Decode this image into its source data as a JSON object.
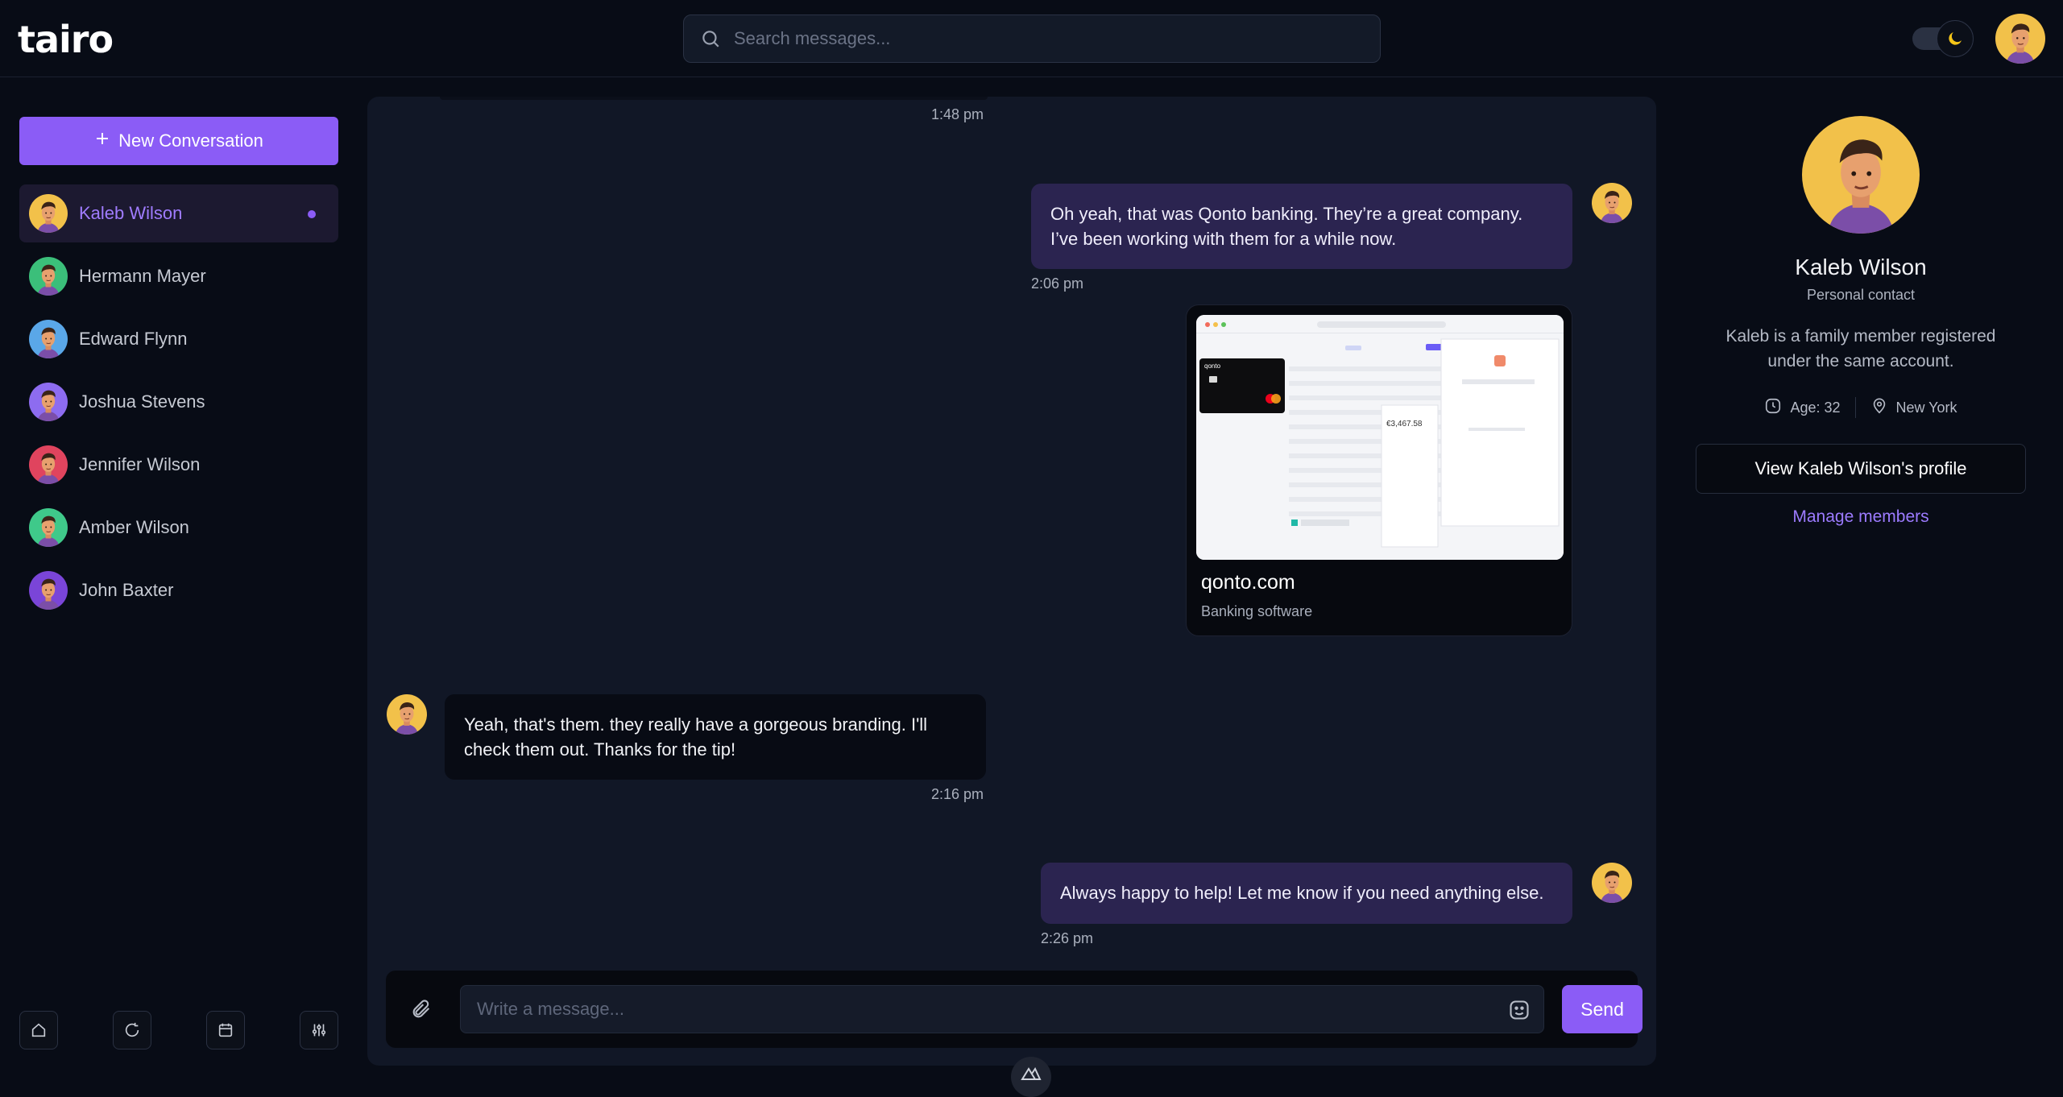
{
  "app": {
    "logo": "tairo"
  },
  "search": {
    "placeholder": "Search messages..."
  },
  "sidebar": {
    "new_conversation_label": "New Conversation",
    "contacts": [
      {
        "name": "Kaleb Wilson",
        "active": true,
        "unread": true,
        "avatar_bg": "#f2c14a"
      },
      {
        "name": "Hermann Mayer",
        "avatar_bg": "#3bbf7a"
      },
      {
        "name": "Edward Flynn",
        "avatar_bg": "#5aa7e8"
      },
      {
        "name": "Joshua Stevens",
        "avatar_bg": "#8d6cf0"
      },
      {
        "name": "Jennifer Wilson",
        "avatar_bg": "#e0445e"
      },
      {
        "name": "Amber Wilson",
        "avatar_bg": "#3fc98a"
      },
      {
        "name": "John Baxter",
        "avatar_bg": "#7a45d8"
      }
    ],
    "tools": [
      "home-icon",
      "chat-rotate-icon",
      "calendar-icon",
      "sliders-icon"
    ]
  },
  "chat": {
    "messages": [
      {
        "time": "1:48 pm"
      },
      {
        "direction": "out",
        "text": "Oh yeah, that was Qonto banking. They’re a great company. I’ve been working with them for a while now.",
        "time": "2:06 pm"
      },
      {
        "type": "link",
        "domain": "qonto.com",
        "description": "Banking software",
        "brand": "qonto",
        "preview_amount": "€3,467.58"
      },
      {
        "direction": "in",
        "text": "Yeah, that's them. they really have a gorgeous branding. I'll check them out. Thanks for the tip!",
        "time": "2:16 pm"
      },
      {
        "direction": "out",
        "text": "Always happy to help! Let me know if you need anything else.",
        "time": "2:26 pm"
      }
    ],
    "composer": {
      "placeholder": "Write a message...",
      "send_label": "Send"
    }
  },
  "profile": {
    "name": "Kaleb Wilson",
    "type": "Personal contact",
    "bio": "Kaleb is a family member registered under the same account.",
    "age": "Age: 32",
    "location": "New York",
    "view_button": "View Kaleb Wilson's profile",
    "manage_link": "Manage members"
  },
  "colors": {
    "accent": "#8b5cf6",
    "background": "#080c16",
    "panel": "#111726",
    "out_bubble": "#2b2450"
  }
}
